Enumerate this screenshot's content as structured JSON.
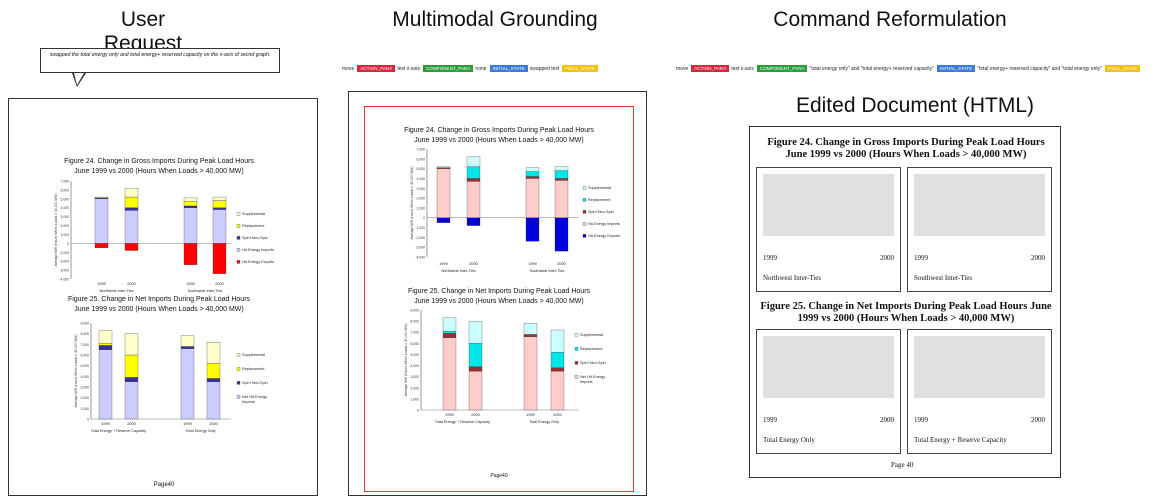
{
  "headings": {
    "user_request": "User Request",
    "multimodal_grounding": "Multimodal Grounding",
    "command_reformulation": "Command Reformulation",
    "edited_document": "Edited Document (HTML)"
  },
  "request_text": "swapped the total energy only and total energy+ reserved capacity on the x-axis of secnd graph.",
  "grounding_tags": [
    {
      "text": "move",
      "kind": "plain"
    },
    {
      "text": "ACTION_PARA",
      "kind": "tag",
      "color": "#d7263d"
    },
    {
      "text": "text x-axis",
      "kind": "plain"
    },
    {
      "text": "COMPONENT_PARA",
      "kind": "tag",
      "color": "#2a9d3a"
    },
    {
      "text": "none",
      "kind": "plain"
    },
    {
      "text": "INITIAL_STATE",
      "kind": "tag",
      "color": "#3a7bd5"
    },
    {
      "text": "swapped text",
      "kind": "plain"
    },
    {
      "text": "FINAL_STATE",
      "kind": "tag",
      "color": "#f4c20d"
    }
  ],
  "reform_tags": [
    {
      "text": "move",
      "kind": "plain"
    },
    {
      "text": "ACTION_PARA",
      "kind": "tag",
      "color": "#d7263d"
    },
    {
      "text": "text x-axis",
      "kind": "plain"
    },
    {
      "text": "COMPONENT_PARA",
      "kind": "tag",
      "color": "#2a9d3a"
    },
    {
      "text": "\"total energy only\" and \"total energy+ reserved capacity\"",
      "kind": "plain"
    },
    {
      "text": "INITIAL_STATE",
      "kind": "tag",
      "color": "#3a7bd5"
    },
    {
      "text": "\"total energy+ reserved capacity\" and \"total energy only\"",
      "kind": "plain"
    },
    {
      "text": "FINAL_STATE",
      "kind": "tag",
      "color": "#f4c20d"
    }
  ],
  "fig24_title": "Figure 24. Change in Gross Imports During Peak Load Hours",
  "fig24_sub": "June 1999 vs 2000 (Hours When Loads > 40,000 MW)",
  "fig25_title": "Figure 25. Change in Net Imports During Peak Load Hours",
  "fig25_sub": "June 1999 vs 2000 (Hours When Loads > 40,000 MW)",
  "page_label": "Page40",
  "html_doc": {
    "fig24_title": "Figure 24. Change in Gross Imports During Peak Load Hours June 1999 vs 2000 (Hours When Loads > 40,000 MW)",
    "fig25_title": "Figure 25. Change in Net Imports During Peak Load Hours June 1999 vs 2000 (Hours When Loads > 40,000 MW)",
    "year_a": "1999",
    "year_b": "2000",
    "fig24_left_label": "Northwest Inter-Ties",
    "fig24_right_label": "Southwest Inter-Ties",
    "fig25_left_label": "Total Energy Only",
    "fig25_right_label": "Total Energy + Reserve Capacity",
    "page": "Page 40"
  },
  "chart_data": [
    {
      "type": "bar",
      "title": "Figure 24. Change in Gross Imports During Peak Load Hours",
      "ylabel": "Average MW (Hours When Loads > 40,000 MW)",
      "ylim": [
        -4000,
        7000
      ],
      "categories": [
        "1999",
        "2000",
        "1999",
        "2000"
      ],
      "groups": [
        "Northwest Inter-Ties",
        "Southwest Inter-Ties"
      ],
      "series": [
        {
          "name": "Supplemental",
          "values": [
            100,
            1000,
            400,
            400
          ]
        },
        {
          "name": "Replacement",
          "values": [
            0,
            1200,
            500,
            800
          ]
        },
        {
          "name": "Spin+Non-Spin",
          "values": [
            100,
            300,
            200,
            200
          ]
        },
        {
          "name": "HA Energy Imports",
          "values": [
            5000,
            3700,
            4000,
            3800
          ]
        },
        {
          "name": "HA Energy Exports",
          "values": [
            -500,
            -800,
            -2400,
            -3400
          ]
        }
      ]
    },
    {
      "type": "bar",
      "title": "Figure 25. Change in Net Imports During Peak Load Hours",
      "ylabel": "Average MW (Hours When Loads > 40,000 MW)",
      "ylim": [
        0,
        9000
      ],
      "categories": [
        "1999",
        "2000",
        "1999",
        "2000"
      ],
      "groups": [
        "Total Energy + Reserve Capacity",
        "Total Energy Only"
      ],
      "series": [
        {
          "name": "Supplemental",
          "values": [
            1200,
            2000,
            1000,
            2000
          ]
        },
        {
          "name": "Replacement",
          "values": [
            200,
            2100,
            0,
            1400
          ]
        },
        {
          "name": "Spin+Non-Spin",
          "values": [
            400,
            400,
            200,
            300
          ]
        },
        {
          "name": "Net HA Energy Imports",
          "values": [
            6500,
            3500,
            6600,
            3500
          ]
        }
      ]
    }
  ],
  "colors_original": [
    "#ffffcc",
    "#ffff00",
    "#333399",
    "#ccccff",
    "#ff0000"
  ],
  "colors_grounding": [
    "#ccffff",
    "#00e5e5",
    "#993333",
    "#ffcccc",
    "#0000dd"
  ]
}
